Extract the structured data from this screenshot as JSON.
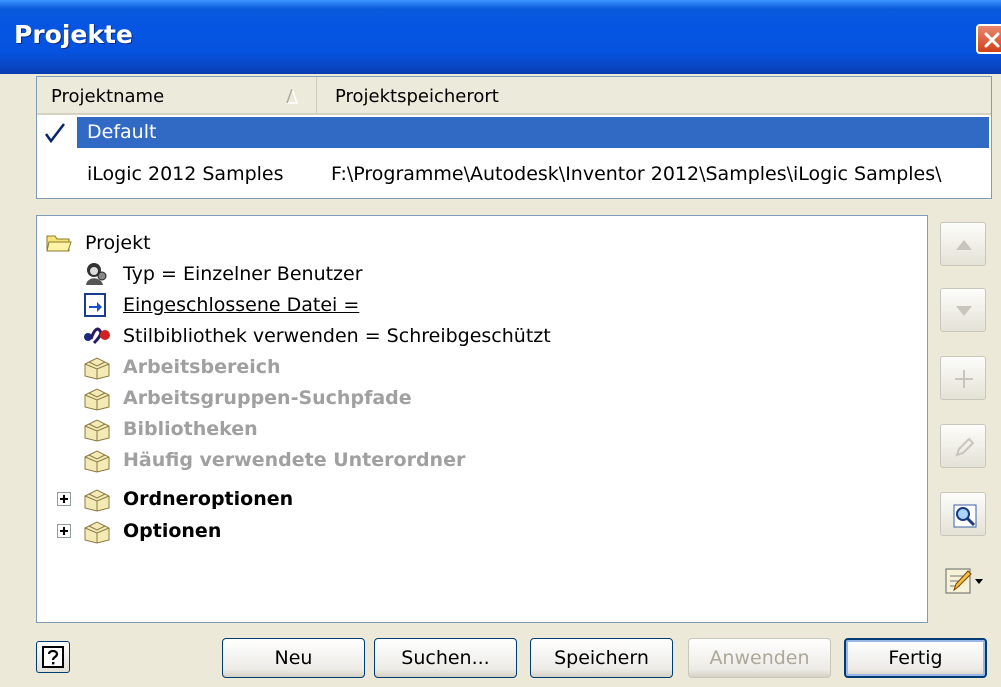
{
  "window": {
    "title": "Projekte"
  },
  "project_list": {
    "columns": [
      "Projektname",
      "Projektspeicherort"
    ],
    "rows": [
      {
        "name": "Default",
        "path": "",
        "active": true
      },
      {
        "name": "iLogic 2012 Samples",
        "path": "F:\\Programme\\Autodesk\\Inventor 2012\\Samples\\iLogic Samples\\",
        "active": false
      }
    ]
  },
  "tree": {
    "root": "Projekt",
    "items": [
      {
        "label": "Typ = Einzelner Benutzer",
        "icon": "user-type-icon",
        "style": "normal"
      },
      {
        "label": "Eingeschlossene Datei =",
        "icon": "included-file-icon",
        "style": "underline"
      },
      {
        "label": "Stilbibliothek verwenden = Schreibgeschützt",
        "icon": "style-library-icon",
        "style": "normal"
      },
      {
        "label": "Arbeitsbereich",
        "icon": "folder-icon",
        "style": "gray"
      },
      {
        "label": "Arbeitsgruppen-Suchpfade",
        "icon": "folder-icon",
        "style": "gray"
      },
      {
        "label": "Bibliotheken",
        "icon": "folder-icon",
        "style": "gray"
      },
      {
        "label": "Häufig verwendete Unterordner",
        "icon": "folder-icon",
        "style": "gray"
      },
      {
        "label": "Ordneroptionen",
        "icon": "folder-icon",
        "style": "bold",
        "expandable": true
      },
      {
        "label": "Optionen",
        "icon": "folder-icon",
        "style": "bold",
        "expandable": true
      }
    ]
  },
  "buttons": {
    "new": "Neu",
    "search": "Suchen...",
    "save": "Speichern",
    "apply": "Anwenden",
    "done": "Fertig"
  },
  "colors": {
    "selection": "#316ac5",
    "titlebar": "#0554e3",
    "disabled_text": "#a0a0a0"
  }
}
